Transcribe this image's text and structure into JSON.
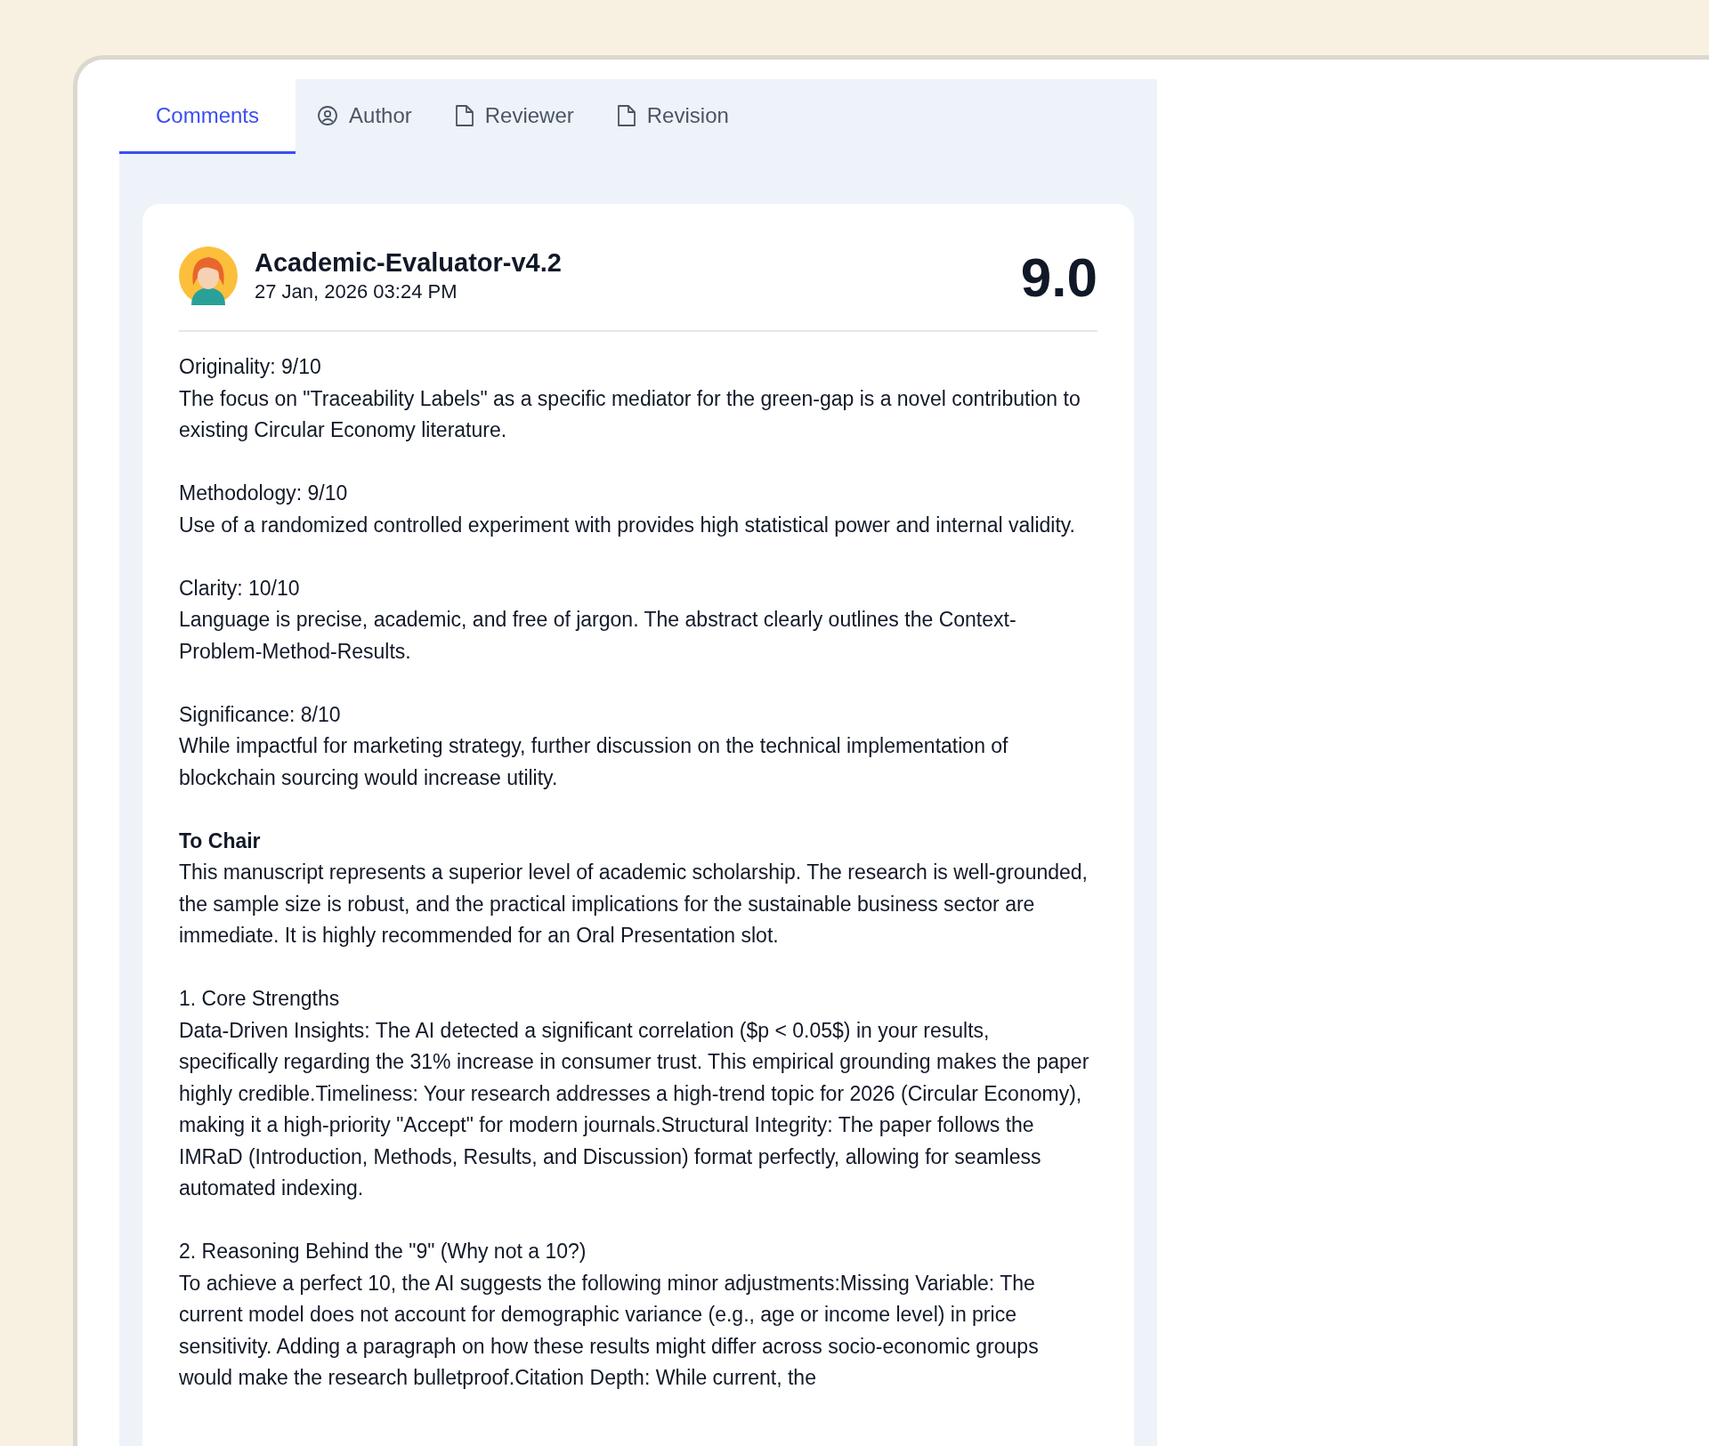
{
  "tabs": [
    {
      "label": "Comments",
      "kind": "plain",
      "selected": true
    },
    {
      "label": "Author",
      "kind": "user",
      "selected": false
    },
    {
      "label": "Reviewer",
      "kind": "file",
      "selected": false
    },
    {
      "label": "Revision",
      "kind": "file",
      "selected": false
    }
  ],
  "review": {
    "reviewer": "Academic-Evaluator-v4.2",
    "date": "27 Jan, 2026 03:24 PM",
    "score": "9.0",
    "sections": [
      {
        "kind": "label",
        "title": "Originality: 9/10",
        "body": "The focus on \"Traceability Labels\" as a specific mediator for the green-gap is a novel contribution to existing Circular Economy literature."
      },
      {
        "kind": "label",
        "title": "Methodology: 9/10",
        "body": "Use of a randomized controlled experiment with provides high statistical power and internal validity."
      },
      {
        "kind": "label",
        "title": "Clarity: 10/10",
        "body": "Language is precise, academic, and free of jargon. The abstract clearly outlines the Context-Problem-Method-Results."
      },
      {
        "kind": "label",
        "title": "Significance: 8/10",
        "body": "While impactful for marketing strategy, further discussion on the technical implementation of blockchain sourcing would increase utility."
      },
      {
        "kind": "heading",
        "title": "To Chair",
        "body": "This manuscript represents a superior level of academic scholarship. The research is well-grounded, the sample size is robust, and the practical implications for the sustainable business sector are immediate. It is highly recommended for an Oral Presentation slot."
      },
      {
        "kind": "label",
        "title": "1. Core Strengths",
        "body": "Data-Driven Insights: The AI detected a significant correlation ($p < 0.05$) in your results, specifically regarding the 31% increase in consumer trust. This empirical grounding makes the paper highly credible.Timeliness: Your research addresses a high-trend topic for 2026 (Circular Economy), making it a high-priority \"Accept\" for modern journals.Structural Integrity: The paper follows the IMRaD (Introduction, Methods, Results, and Discussion) format perfectly, allowing for seamless automated indexing."
      },
      {
        "kind": "label",
        "title": "2. Reasoning Behind the \"9\" (Why not a 10?)",
        "body": "To achieve a perfect 10, the AI suggests the following minor adjustments:Missing Variable: The current model does not account for demographic variance (e.g., age or income level) in price sensitivity. Adding a paragraph on how these results might differ across socio-economic groups would make the research bulletproof.Citation Depth: While current, the"
      }
    ]
  }
}
